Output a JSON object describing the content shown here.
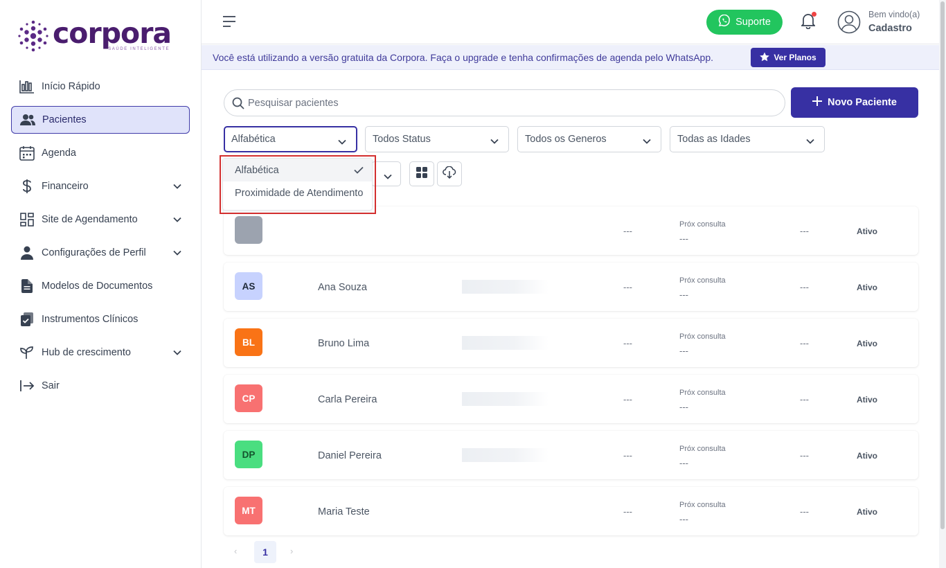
{
  "brand": {
    "name": "corpora",
    "tagline": "SAÚDE INTELIGENTE",
    "color": "#4a1d6e"
  },
  "sidebar": {
    "items": [
      {
        "label": "Início Rápido",
        "icon": "chart-bar-icon",
        "expandable": false,
        "active": false
      },
      {
        "label": "Pacientes",
        "icon": "users-icon",
        "expandable": false,
        "active": true
      },
      {
        "label": "Agenda",
        "icon": "calendar-icon",
        "expandable": false,
        "active": false
      },
      {
        "label": "Financeiro",
        "icon": "dollar-icon",
        "expandable": true,
        "active": false
      },
      {
        "label": "Site de Agendamento",
        "icon": "layout-grid-icon",
        "expandable": true,
        "active": false
      },
      {
        "label": "Configurações de Perfil",
        "icon": "user-icon",
        "expandable": true,
        "active": false
      },
      {
        "label": "Modelos de Documentos",
        "icon": "document-icon",
        "expandable": false,
        "active": false
      },
      {
        "label": "Instrumentos Clínicos",
        "icon": "clipboard-check-icon",
        "expandable": false,
        "active": false
      },
      {
        "label": "Hub de crescimento",
        "icon": "sprout-icon",
        "expandable": true,
        "active": false
      },
      {
        "label": "Sair",
        "icon": "logout-icon",
        "expandable": false,
        "active": false
      }
    ]
  },
  "header": {
    "support_label": "Suporte",
    "welcome": "Bem vindo(a)",
    "username": "Cadastro"
  },
  "banner": {
    "text": "Você está utilizando a versão gratuita da Corpora. Faça o upgrade e tenha confirmações de agenda pelo WhatsApp.",
    "button_label": "Ver Planos"
  },
  "search": {
    "placeholder": "Pesquisar pacientes",
    "value": ""
  },
  "new_patient_label": "Novo Paciente",
  "filters": {
    "sort": "Alfabética",
    "status": "Todos Status",
    "gender": "Todos os Generos",
    "age": "Todas as Idades"
  },
  "sort_dropdown": {
    "options": [
      "Alfabética",
      "Proximidade de Atendimento"
    ],
    "selected": "Alfabética"
  },
  "patients": [
    {
      "initials": "",
      "name": "",
      "bg": "#9ca3af",
      "fg": "#ffffff",
      "col1": "---",
      "next_label": "Próx consulta",
      "next": "---",
      "col2": "---",
      "status": "Ativo"
    },
    {
      "initials": "AS",
      "name": "Ana Souza",
      "bg": "#c7d2fe",
      "fg": "#1f2937",
      "col1": "---",
      "next_label": "Próx consulta",
      "next": "---",
      "col2": "---",
      "status": "Ativo"
    },
    {
      "initials": "BL",
      "name": "Bruno Lima",
      "bg": "#f97316",
      "fg": "#ffffff",
      "col1": "---",
      "next_label": "Próx consulta",
      "next": "---",
      "col2": "---",
      "status": "Ativo"
    },
    {
      "initials": "CP",
      "name": "Carla Pereira",
      "bg": "#f87171",
      "fg": "#ffffff",
      "col1": "---",
      "next_label": "Próx consulta",
      "next": "---",
      "col2": "---",
      "status": "Ativo"
    },
    {
      "initials": "DP",
      "name": "Daniel Pereira",
      "bg": "#4ade80",
      "fg": "#14532d",
      "col1": "---",
      "next_label": "Próx consulta",
      "next": "---",
      "col2": "---",
      "status": "Ativo"
    },
    {
      "initials": "MT",
      "name": "Maria Teste",
      "bg": "#f87171",
      "fg": "#ffffff",
      "col1": "---",
      "next_label": "Próx consulta",
      "next": "---",
      "col2": "---",
      "status": "Ativo"
    }
  ],
  "pagination": {
    "prev": "‹",
    "page": "1",
    "next": "›"
  }
}
